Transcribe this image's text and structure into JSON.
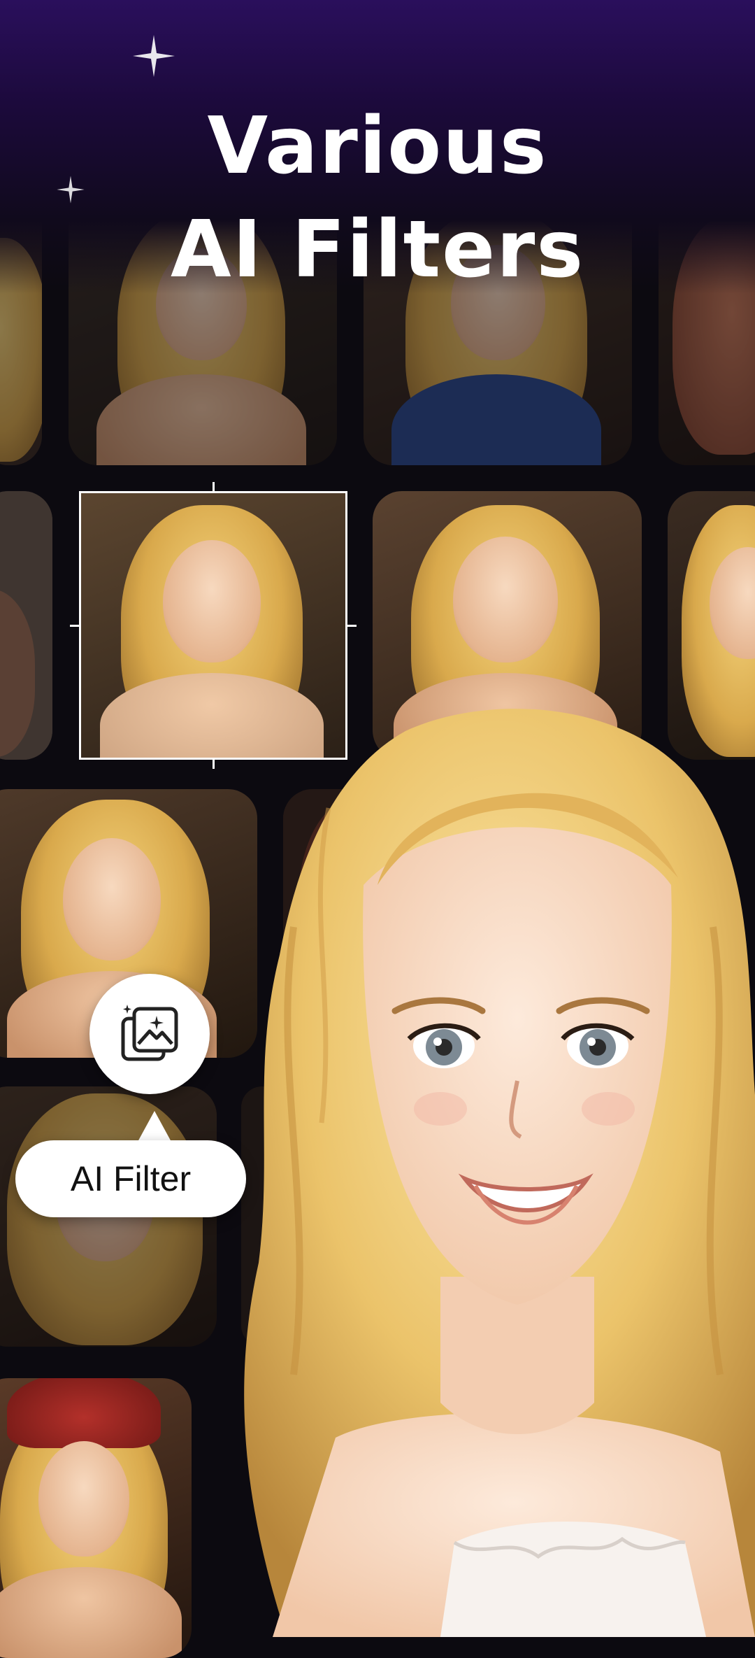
{
  "headline": {
    "line1": "Various",
    "line2": "AI Filters"
  },
  "feature_badge": {
    "icon": "ai-filter-icon",
    "label": "AI Filter"
  },
  "colors": {
    "top_gradient": "#2a0f5c",
    "background": "#0c0a10",
    "hair": "#e9c065",
    "skin": "#f3d3b8",
    "badge_bg": "#ffffff"
  }
}
